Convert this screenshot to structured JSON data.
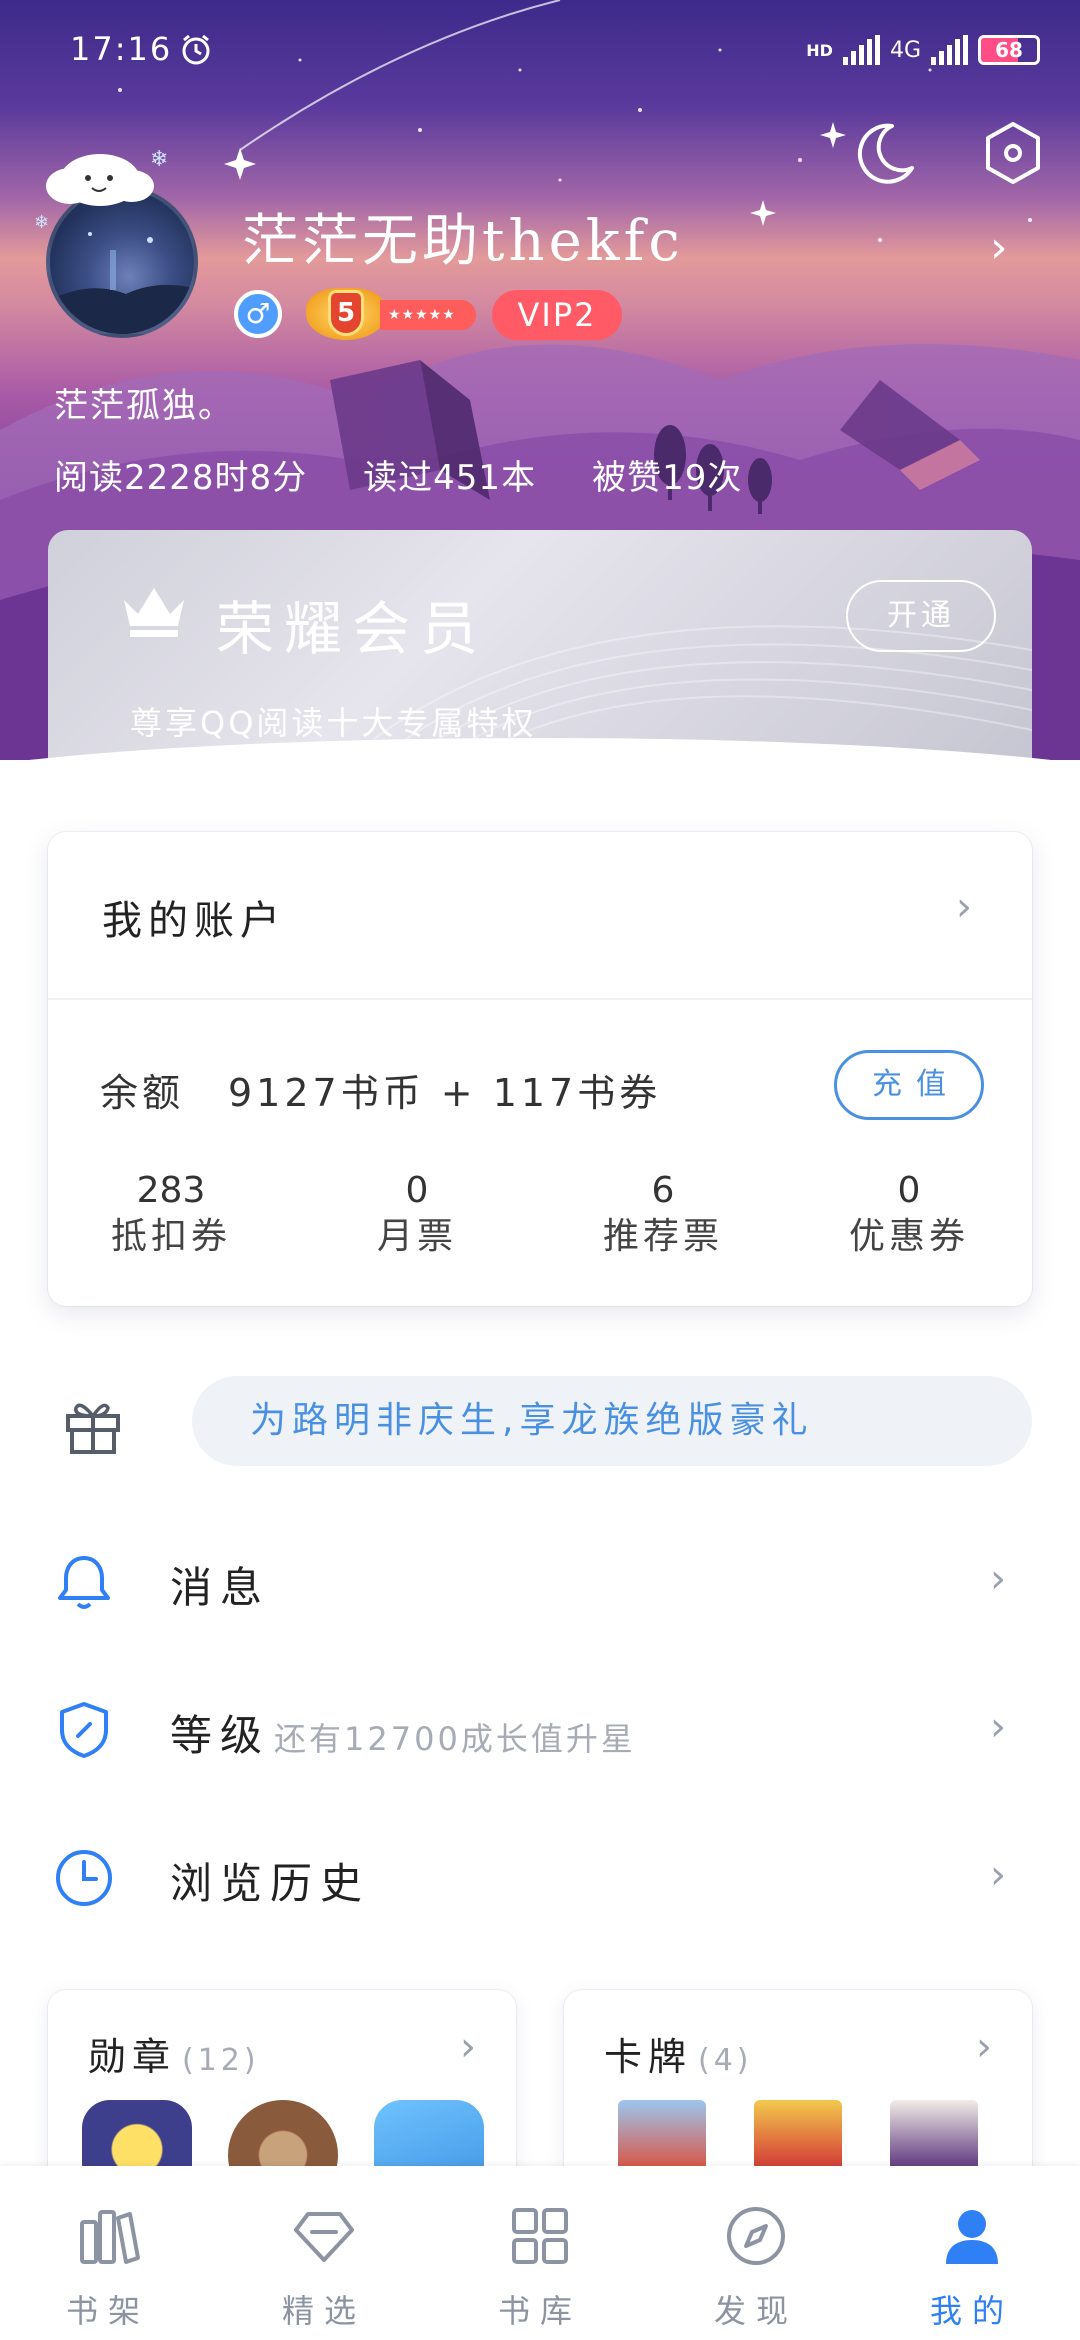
{
  "status_bar": {
    "time": "17:16",
    "network": "4G",
    "hd": "HD",
    "battery": "68"
  },
  "profile": {
    "username": "茫茫无助thekfc",
    "level": "5",
    "vip": "VIP2",
    "signature": "茫茫孤独。",
    "stats": {
      "reading_time": "阅读2228时8分",
      "books_read": "读过451本",
      "likes": "被赞19次"
    }
  },
  "honor_card": {
    "title": "荣耀会员",
    "subtitle": "尊享QQ阅读十大专属特权",
    "button": "开通"
  },
  "account": {
    "title": "我的账户",
    "balance_label": "余额",
    "balance_value": "9127书币 + 117书券",
    "recharge_button": "充值",
    "tickets": [
      {
        "value": "283",
        "label": "抵扣券"
      },
      {
        "value": "0",
        "label": "月票"
      },
      {
        "value": "6",
        "label": "推荐票"
      },
      {
        "value": "0",
        "label": "优惠券"
      }
    ]
  },
  "promo": {
    "text": "为路明非庆生,享龙族绝版豪礼"
  },
  "menu": {
    "messages": "消息",
    "level": "等级",
    "level_hint": "还有12700成长值升星",
    "history": "浏览历史"
  },
  "badges_panel": {
    "title": "勋章",
    "count": "(12)"
  },
  "cards_panel": {
    "title": "卡牌",
    "count": "(4)"
  },
  "bottom_nav": [
    {
      "label": "书架",
      "icon": "bookshelf-icon"
    },
    {
      "label": "精选",
      "icon": "diamond-icon"
    },
    {
      "label": "书库",
      "icon": "grid-icon"
    },
    {
      "label": "发现",
      "icon": "compass-icon"
    },
    {
      "label": "我的",
      "icon": "user-icon"
    }
  ],
  "colors": {
    "accent": "#2f7ff5",
    "link_blue": "#4a90e2",
    "vip_red": "#ff5a66",
    "gray_text": "#a6abb6"
  }
}
